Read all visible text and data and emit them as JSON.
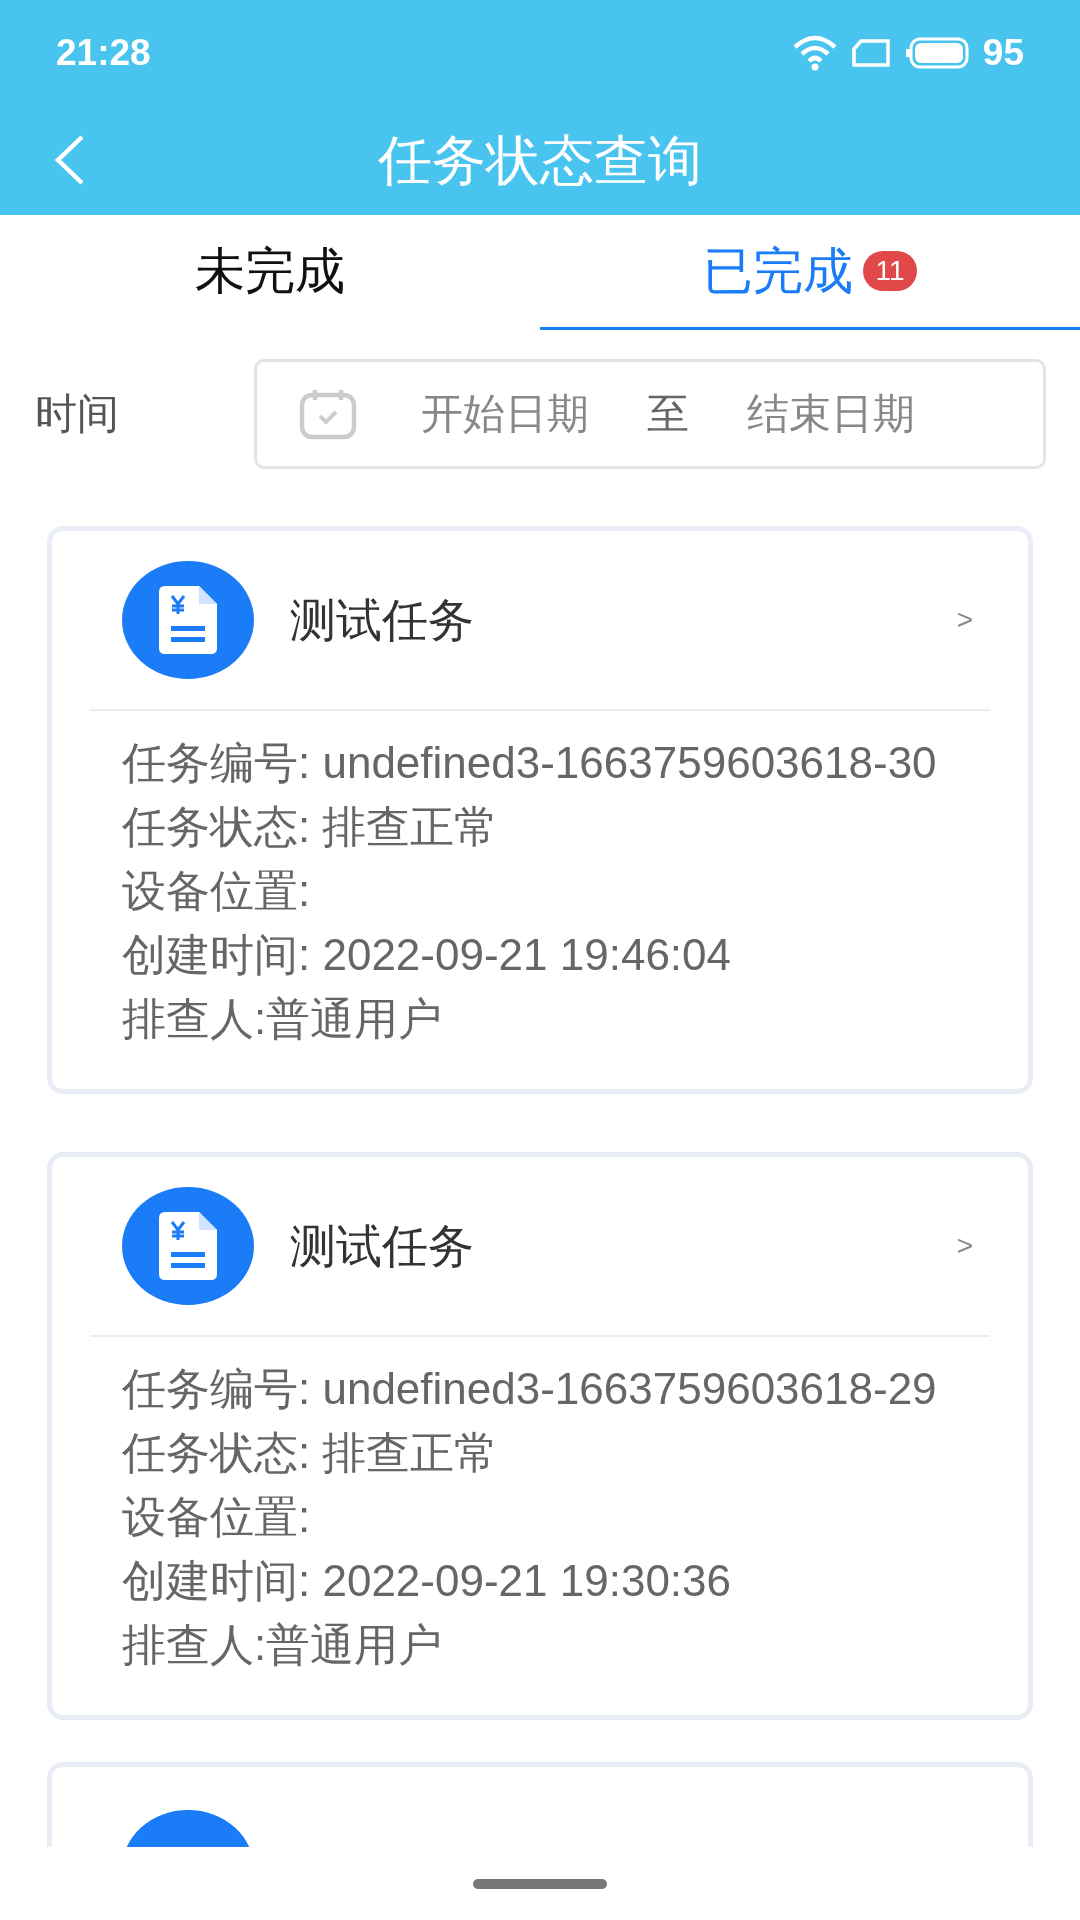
{
  "status_bar": {
    "time": "21:28",
    "battery": "95"
  },
  "header": {
    "title": "任务状态查询"
  },
  "tabs": [
    {
      "label": "未完成",
      "selected": false
    },
    {
      "label": "已完成",
      "selected": true,
      "badge": "11"
    }
  ],
  "filter": {
    "label": "时间",
    "start_placeholder": "开始日期",
    "separator": "至",
    "end_placeholder": "结束日期"
  },
  "cards": [
    {
      "kind": "full",
      "name": "测试任务",
      "arrow": ">",
      "fields": [
        "任务编号: undefined3-1663759603618-30",
        "任务状态: 排查正常",
        "设备位置:",
        "创建时间: 2022-09-21 19:46:04",
        "排查人:普通用户"
      ]
    },
    {
      "kind": "full",
      "name": "测试任务",
      "arrow": ">",
      "fields": [
        "任务编号: undefined3-1663759603618-29",
        "任务状态: 排查正常",
        "设备位置:",
        "创建时间: 2022-09-21 19:30:36",
        "排查人:普通用户"
      ]
    },
    {
      "kind": "clipped"
    }
  ]
}
